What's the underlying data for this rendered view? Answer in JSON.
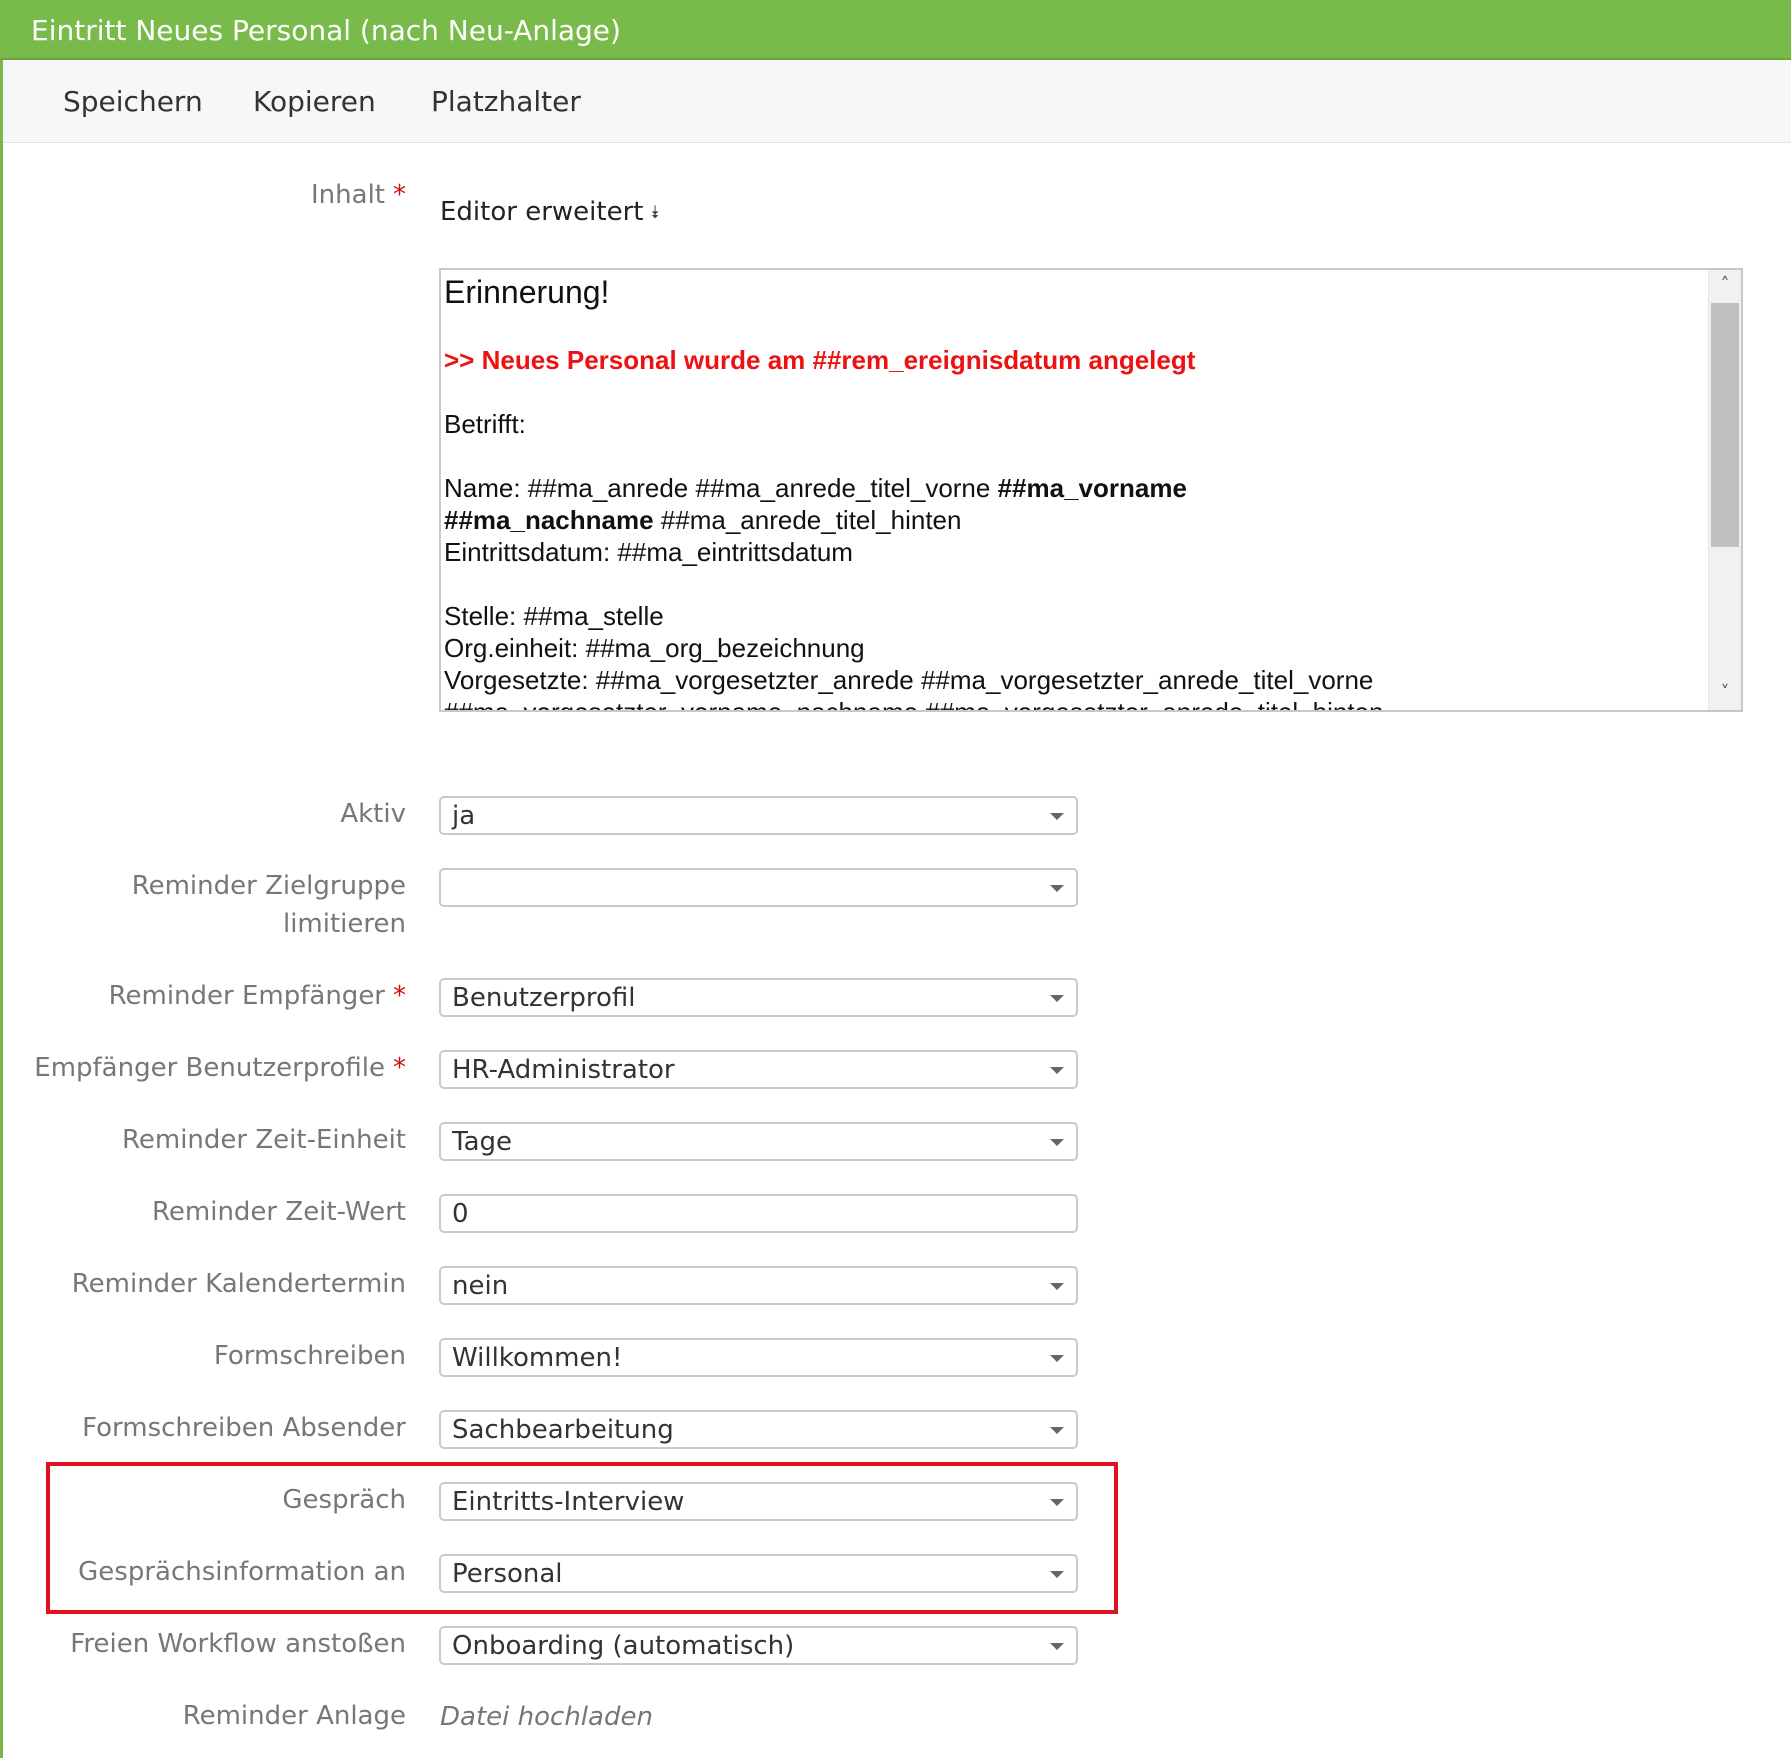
{
  "window": {
    "title": "Eintritt Neues Personal (nach Neu-Anlage)"
  },
  "toolbar": {
    "save": "Speichern",
    "copy": "Kopieren",
    "placeholder": "Platzhalter"
  },
  "colors": {
    "titlebar": "#79bb4a",
    "required": "#cc1111",
    "highlight_box": "#e01020",
    "editor_red_text": "#ee1111"
  },
  "content": {
    "label": "Inhalt",
    "required_mark": "*",
    "editor_toggle": "Editor erweitert",
    "editor_toggle_icon": "double-chevron-down-icon",
    "editor": {
      "heading": "Erinnerung!",
      "red_line": ">> Neues Personal wurde am ##rem_ereignisdatum angelegt",
      "betrifft": "Betrifft:",
      "name_prefix": "Name: ##ma_anrede ##ma_anrede_titel_vorne ",
      "name_bold1": "##ma_vorname",
      "name_bold2": "##ma_nachname",
      "name_suffix": " ##ma_anrede_titel_hinten",
      "eintritt": "Eintrittsdatum: ##ma_eintrittsdatum",
      "stelle": "Stelle: ##ma_stelle",
      "orgeinheit": "Org.einheit: ##ma_org_bezeichnung",
      "vorgesetzte": "Vorgesetzte: ##ma_vorgesetzter_anrede ##ma_vorgesetzter_anrede_titel_vorne",
      "vorgesetzte2": "##ma_vorgesetzter_vorname_nachname ##ma_vorgesetzter_anrede_titel_hinten"
    }
  },
  "fields": {
    "aktiv": {
      "label": "Aktiv",
      "value": "ja"
    },
    "zielgruppe": {
      "label_line1": "Reminder Zielgruppe",
      "label_line2": "limitieren",
      "value": ""
    },
    "empfaenger": {
      "label": "Reminder Empfänger",
      "value": "Benutzerprofil"
    },
    "benutzerprofile": {
      "label": "Empfänger Benutzerprofile",
      "value": "HR-Administrator"
    },
    "zeit_einheit": {
      "label": "Reminder Zeit-Einheit",
      "value": "Tage"
    },
    "zeit_wert": {
      "label": "Reminder Zeit-Wert",
      "value": "0"
    },
    "kalendertermin": {
      "label": "Reminder Kalendertermin",
      "value": "nein"
    },
    "formschreiben": {
      "label": "Formschreiben",
      "value": "Willkommen!"
    },
    "absender": {
      "label": "Formschreiben Absender",
      "value": "Sachbearbeitung"
    },
    "gespraech": {
      "label": "Gespräch",
      "value": "Eintritts-Interview"
    },
    "gespraechsinfo": {
      "label": "Gesprächsinformation an",
      "value": "Personal"
    },
    "workflow": {
      "label": "Freien Workflow anstoßen",
      "value": "Onboarding (automatisch)"
    },
    "anlage": {
      "label": "Reminder Anlage",
      "link": "Datei hochladen"
    }
  }
}
